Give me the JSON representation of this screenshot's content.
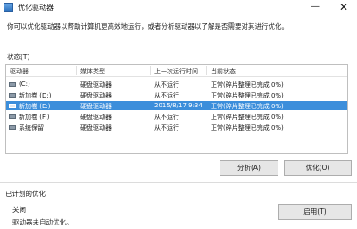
{
  "window": {
    "title": "优化驱动器",
    "minimize_glyph": "—",
    "close_glyph": "✕"
  },
  "description": "你可以优化驱动器以帮助计算机更高效地运行，或者分析驱动器以了解是否需要对其进行优化。",
  "status": {
    "label": "状态(T)",
    "columns": [
      "驱动器",
      "媒体类型",
      "上一次运行时间",
      "当前状态"
    ],
    "rows": [
      {
        "drive": "(C:)",
        "media": "硬盘驱动器",
        "last_run": "从不运行",
        "state": "正常(碎片整理已完成 0%)",
        "icon": "hard-drive-icon",
        "selected": false
      },
      {
        "drive": "新加卷 (D:)",
        "media": "硬盘驱动器",
        "last_run": "从不运行",
        "state": "正常(碎片整理已完成 0%)",
        "icon": "hard-drive-icon",
        "selected": false
      },
      {
        "drive": "新加卷 (E:)",
        "media": "硬盘驱动器",
        "last_run": "2015/8/17 9:34",
        "state": "正常(碎片整理已完成 0%)",
        "icon": "hard-drive-icon",
        "selected": true
      },
      {
        "drive": "新加卷 (F:)",
        "media": "硬盘驱动器",
        "last_run": "从不运行",
        "state": "正常(碎片整理已完成 0%)",
        "icon": "hard-drive-icon",
        "selected": false
      },
      {
        "drive": "系统保留",
        "media": "硬盘驱动器",
        "last_run": "从不运行",
        "state": "正常(碎片整理已完成 0%)",
        "icon": "hard-drive-icon",
        "selected": false
      }
    ],
    "selection_color": "#3c8edb"
  },
  "actions": {
    "analyze": "分析(A)",
    "optimize": "优化(O)"
  },
  "scheduled": {
    "label": "已计划的优化",
    "status": "关闭",
    "note": "驱动器未自动优化。",
    "enable_button": "启用(T)"
  }
}
